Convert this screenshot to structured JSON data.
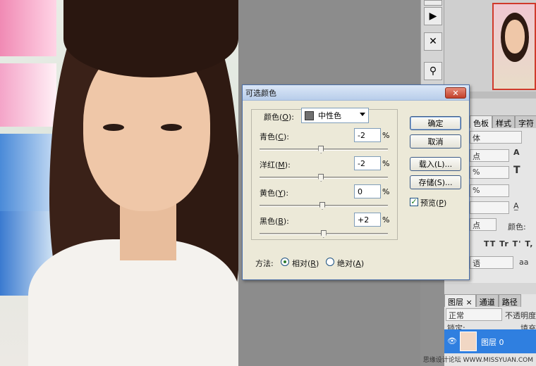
{
  "dialog": {
    "title": "可选颜色",
    "close_icon": "close-icon",
    "color_label": "颜色(",
    "color_key": "O",
    "color_label_end": "):",
    "color_value": "中性色",
    "sliders": [
      {
        "label_pre": "青色(",
        "key": "C",
        "label_post": "):",
        "value": "-2",
        "level": -2
      },
      {
        "label_pre": "洋红(",
        "key": "M",
        "label_post": "):",
        "value": "-2",
        "level": -2
      },
      {
        "label_pre": "黄色(",
        "key": "Y",
        "label_post": "):",
        "value": "0",
        "level": 0
      },
      {
        "label_pre": "黑色(",
        "key": "B",
        "label_post": "):",
        "value": "+2",
        "level": 2
      }
    ],
    "percent": "%",
    "buttons": {
      "ok": "确定",
      "cancel": "取消",
      "load": "载入(L)...",
      "save": "存储(S)..."
    },
    "preview_label": "预览(",
    "preview_key": "P",
    "preview_end": ")",
    "preview_checked": true,
    "method_label": "方法:",
    "method_relative": "相对(",
    "method_relative_key": "R",
    "method_relative_end": ")",
    "method_absolute": "绝对(",
    "method_absolute_key": "A",
    "method_absolute_end": ")",
    "method_selected": "relative"
  },
  "panels": {
    "char_tabs": [
      "色板",
      "样式",
      "字符"
    ],
    "char_rows": [
      "体",
      "点",
      "%",
      "%",
      "点"
    ],
    "color_label": "颜色:",
    "type_styles": "TT Tr T' T,",
    "lang": "语",
    "aa": "aa",
    "layer_tabs": [
      "图层 ×",
      "通道",
      "路径"
    ],
    "blend_mode": "正常",
    "opacity_label": "不透明度",
    "lock_label": "锁定:",
    "fill_label": "填充",
    "layer_name": "图层 0"
  },
  "watermark": "思缘设计论坛  WWW.MISSYUAN.COM",
  "colors": {
    "accent": "#2f7fe0",
    "close": "#c1402b",
    "dialog_bg": "#ece9d8"
  }
}
